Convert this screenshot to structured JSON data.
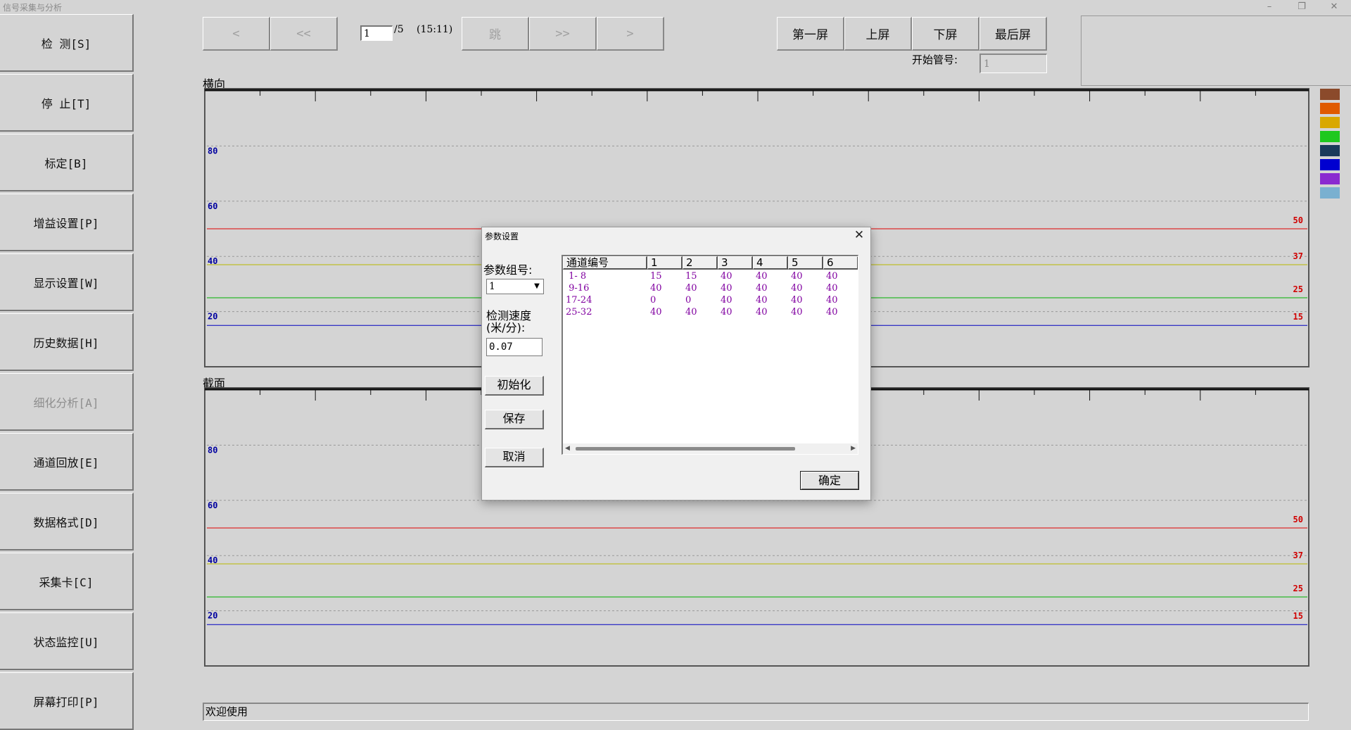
{
  "window": {
    "title": "信号采集与分析",
    "controls": {
      "minimize": "–",
      "restore": "❐",
      "close": "✕"
    }
  },
  "sidebar": {
    "items": [
      {
        "label": "检  测[S]",
        "enabled": true
      },
      {
        "label": "停 止[T]",
        "enabled": true
      },
      {
        "label": "标定[B]",
        "enabled": true
      },
      {
        "label": "增益设置[P]",
        "enabled": true
      },
      {
        "label": "显示设置[W]",
        "enabled": true
      },
      {
        "label": "历史数据[H]",
        "enabled": true
      },
      {
        "label": "细化分析[A]",
        "enabled": false
      },
      {
        "label": "通道回放[E]",
        "enabled": true
      },
      {
        "label": "数据格式[D]",
        "enabled": true
      },
      {
        "label": "采集卡[C]",
        "enabled": true
      },
      {
        "label": "状态监控[U]",
        "enabled": true
      },
      {
        "label": "屏幕打印[P]",
        "enabled": true
      }
    ]
  },
  "toolbar": {
    "prev": "<",
    "prev_fast": "<<",
    "page_value": "1",
    "page_total": "/5",
    "time": "(15:11)",
    "jump": "跳",
    "next_fast": ">>",
    "next": ">",
    "first_screen": "第一屏",
    "prev_screen": "上屏",
    "next_screen": "下屏",
    "last_screen": "最后屏",
    "start_tube_label": "开始管号:",
    "start_tube_value": "1"
  },
  "charts": {
    "horizontal": {
      "label": "横向"
    },
    "section": {
      "label": "截面"
    }
  },
  "legend_colors": [
    "#8b4a2b",
    "#e05a00",
    "#d9a800",
    "#1ec81e",
    "#1a3a5a",
    "#0000d0",
    "#8a2ad0",
    "#7ab0d0"
  ],
  "status_text": "欢迎使用",
  "dialog": {
    "title": "参数设置",
    "close": "✕",
    "group_label": "参数组号:",
    "group_value": "1",
    "speed_label_1": "检测速度",
    "speed_label_2": "(米/分):",
    "speed_value": "0.07",
    "init_button": "初始化",
    "save_button": "保存",
    "cancel_button": "取消",
    "ok_button": "确定",
    "table": {
      "headers": [
        "通道编号",
        "1",
        "2",
        "3",
        "4",
        "5",
        "6"
      ],
      "rows": [
        [
          " 1- 8",
          "15",
          "15",
          "40",
          "40",
          "40",
          "40"
        ],
        [
          " 9-16",
          "40",
          "40",
          "40",
          "40",
          "40",
          "40"
        ],
        [
          "17-24",
          "0",
          "0",
          "40",
          "40",
          "40",
          "40"
        ],
        [
          "25-32",
          "40",
          "40",
          "40",
          "40",
          "40",
          "40"
        ]
      ]
    }
  },
  "chart_data": [
    {
      "type": "line",
      "title": "横向",
      "ylim": [
        0,
        100
      ],
      "yticks": [
        20,
        40,
        60,
        80
      ],
      "grid": true,
      "series": [
        {
          "values": [
            50,
            50
          ],
          "color": "#e00000",
          "label": "50"
        },
        {
          "values": [
            37,
            37
          ],
          "color": "#b8b800",
          "label": "37"
        },
        {
          "values": [
            25,
            25
          ],
          "color": "#00b000",
          "label": "25"
        },
        {
          "values": [
            15,
            15
          ],
          "color": "#0000c0",
          "label": "15"
        }
      ]
    },
    {
      "type": "line",
      "title": "截面",
      "ylim": [
        0,
        100
      ],
      "yticks": [
        20,
        40,
        60,
        80
      ],
      "grid": true,
      "series": [
        {
          "values": [
            50,
            50
          ],
          "color": "#e00000",
          "label": "50"
        },
        {
          "values": [
            37,
            37
          ],
          "color": "#b8b800",
          "label": "37"
        },
        {
          "values": [
            25,
            25
          ],
          "color": "#00b000",
          "label": "25"
        },
        {
          "values": [
            15,
            15
          ],
          "color": "#0000c0",
          "label": "15"
        }
      ]
    }
  ]
}
